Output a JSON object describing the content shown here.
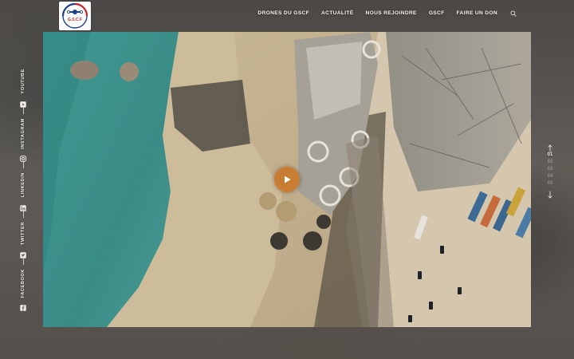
{
  "brand": {
    "logo_text": "G.S.C.F"
  },
  "nav": {
    "items": [
      {
        "label": "DRONES DU GSCF"
      },
      {
        "label": "ACTUALITÉ"
      },
      {
        "label": "NOUS REJOINDRE"
      },
      {
        "label": "GSCF"
      },
      {
        "label": "FAIRE UN DON"
      }
    ],
    "search_icon": "search-icon"
  },
  "social": {
    "items": [
      {
        "label": "YOUTUBE",
        "icon": "youtube-icon"
      },
      {
        "label": "INSTAGRAM",
        "icon": "instagram-icon"
      },
      {
        "label": "LINKEDIN",
        "icon": "linkedin-icon"
      },
      {
        "label": "TWITTER",
        "icon": "twitter-icon"
      },
      {
        "label": "FACEBOOK",
        "icon": "facebook-icon"
      }
    ]
  },
  "slider": {
    "slides": [
      "01",
      "02",
      "03",
      "04",
      "05"
    ],
    "active_index": 0
  },
  "colors": {
    "accent": "#c97a2c",
    "sea": "#3f8e8a",
    "nav_text": "#f4f1ec"
  }
}
